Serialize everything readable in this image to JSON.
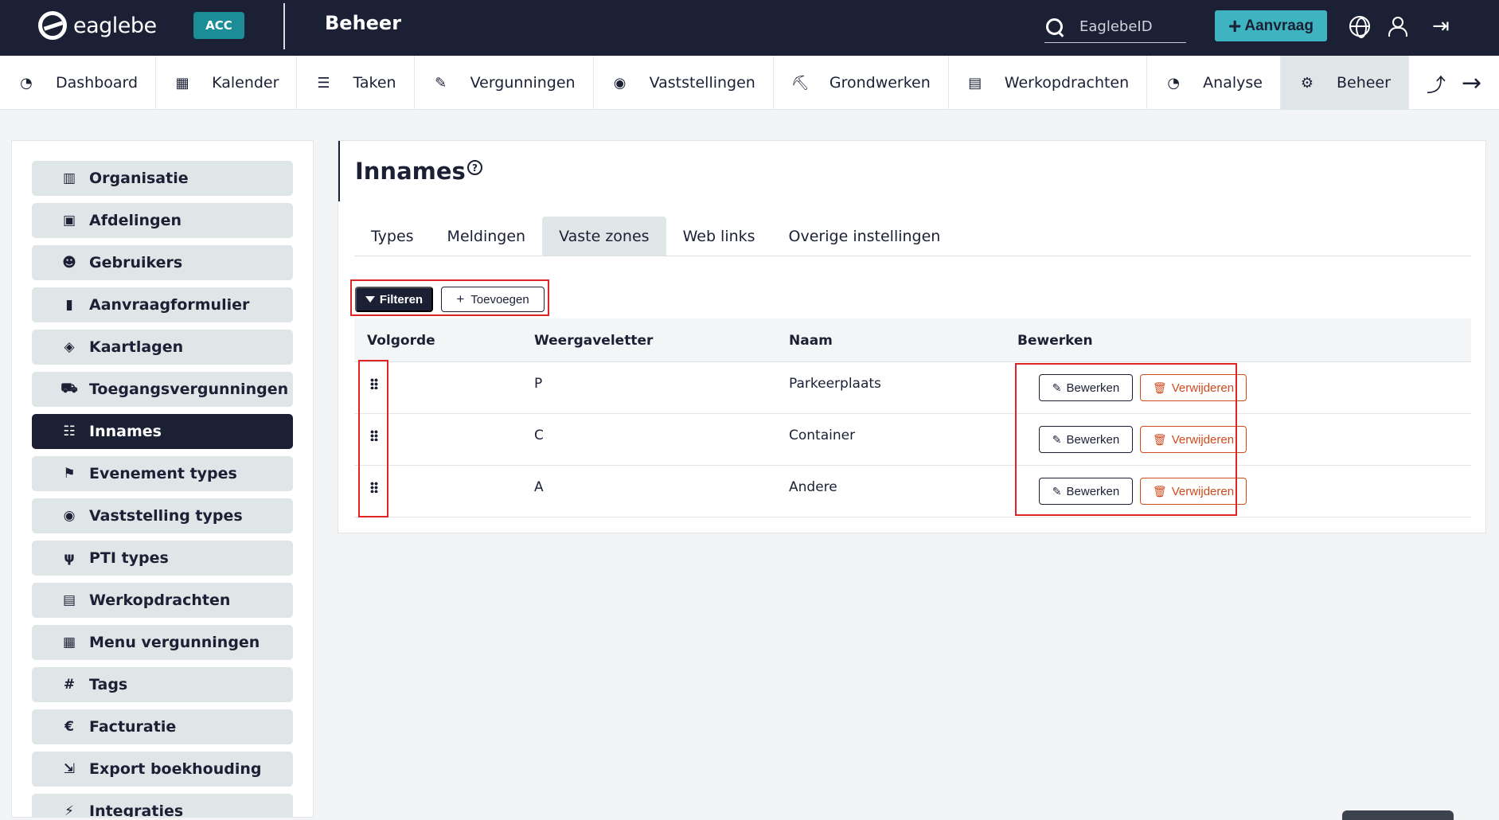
{
  "topbar": {
    "logo_text": "eaglebe",
    "env_badge": "ACC",
    "section_title": "Beheer",
    "search_placeholder": "EaglebeID",
    "request_button": "Aanvraag",
    "colors": {
      "bar": "#1b2035",
      "accent": "#3fb4c1",
      "badge": "#1c8d96"
    }
  },
  "nav": {
    "items": [
      {
        "label": "Dashboard",
        "icon": "dashboard-icon"
      },
      {
        "label": "Kalender",
        "icon": "calendar-icon"
      },
      {
        "label": "Taken",
        "icon": "tasks-icon"
      },
      {
        "label": "Vergunningen",
        "icon": "permit-icon"
      },
      {
        "label": "Vaststellingen",
        "icon": "eye-icon"
      },
      {
        "label": "Grondwerken",
        "icon": "digging-icon"
      },
      {
        "label": "Werkopdrachten",
        "icon": "document-icon"
      },
      {
        "label": "Analyse",
        "icon": "analysis-icon"
      },
      {
        "label": "Beheer",
        "icon": "cogs-icon",
        "active": true
      }
    ]
  },
  "sidebar": {
    "items": [
      {
        "label": "Organisatie",
        "icon": "building-icon"
      },
      {
        "label": "Afdelingen",
        "icon": "columns-icon"
      },
      {
        "label": "Gebruikers",
        "icon": "users-icon"
      },
      {
        "label": "Aanvraagformulier",
        "icon": "clipboard-icon"
      },
      {
        "label": "Kaartlagen",
        "icon": "layers-icon"
      },
      {
        "label": "Toegangsvergunningen",
        "icon": "car-icon"
      },
      {
        "label": "Innames",
        "icon": "signs-icon",
        "active": true
      },
      {
        "label": "Evenement types",
        "icon": "flag-icon"
      },
      {
        "label": "Vaststelling types",
        "icon": "eye-icon"
      },
      {
        "label": "PTI types",
        "icon": "utensils-icon"
      },
      {
        "label": "Werkopdrachten",
        "icon": "document-icon"
      },
      {
        "label": "Menu vergunningen",
        "icon": "table-icon"
      },
      {
        "label": "Tags",
        "icon": "hashtag-icon"
      },
      {
        "label": "Facturatie",
        "icon": "euro-icon"
      },
      {
        "label": "Export boekhouding",
        "icon": "file-export-icon"
      },
      {
        "label": "Integraties",
        "icon": "plug-icon"
      }
    ]
  },
  "main": {
    "title": "Innames",
    "help_icon": "question-circle-icon",
    "tabs": [
      {
        "label": "Types"
      },
      {
        "label": "Meldingen"
      },
      {
        "label": "Vaste zones",
        "active": true
      },
      {
        "label": "Web links"
      },
      {
        "label": "Overige instellingen"
      }
    ],
    "toolbar": {
      "filter_label": "Filteren",
      "add_label": "Toevoegen"
    },
    "table": {
      "headers": [
        "Volgorde",
        "Weergaveletter",
        "Naam",
        "Bewerken"
      ],
      "rows": [
        {
          "letter": "P",
          "name": "Parkeerplaats"
        },
        {
          "letter": "C",
          "name": "Container"
        },
        {
          "letter": "A",
          "name": "Andere"
        }
      ],
      "edit_label": "Bewerken",
      "delete_label": "Verwijderen"
    }
  }
}
